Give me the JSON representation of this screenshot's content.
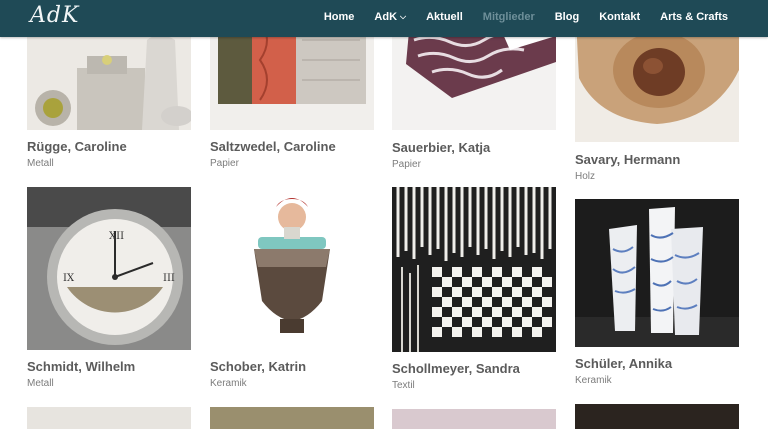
{
  "header": {
    "logo": "AdK",
    "nav": [
      {
        "label": "Home"
      },
      {
        "label": "AdK"
      },
      {
        "label": "Aktuell"
      },
      {
        "label": "Mitglieder"
      },
      {
        "label": "Blog"
      },
      {
        "label": "Kontakt"
      },
      {
        "label": "Arts & Crafts"
      }
    ]
  },
  "members": [
    {
      "name": "Rügge, Caroline",
      "category": "Metall"
    },
    {
      "name": "Saltzwedel, Caroline",
      "category": "Papier"
    },
    {
      "name": "Sauerbier, Katja",
      "category": "Papier"
    },
    {
      "name": "Savary, Hermann",
      "category": "Holz"
    },
    {
      "name": "Schmidt, Wilhelm",
      "category": "Metall"
    },
    {
      "name": "Schober, Katrin",
      "category": "Keramik"
    },
    {
      "name": "Schollmeyer, Sandra",
      "category": "Textil"
    },
    {
      "name": "Schüler, Annika",
      "category": "Keramik"
    }
  ]
}
